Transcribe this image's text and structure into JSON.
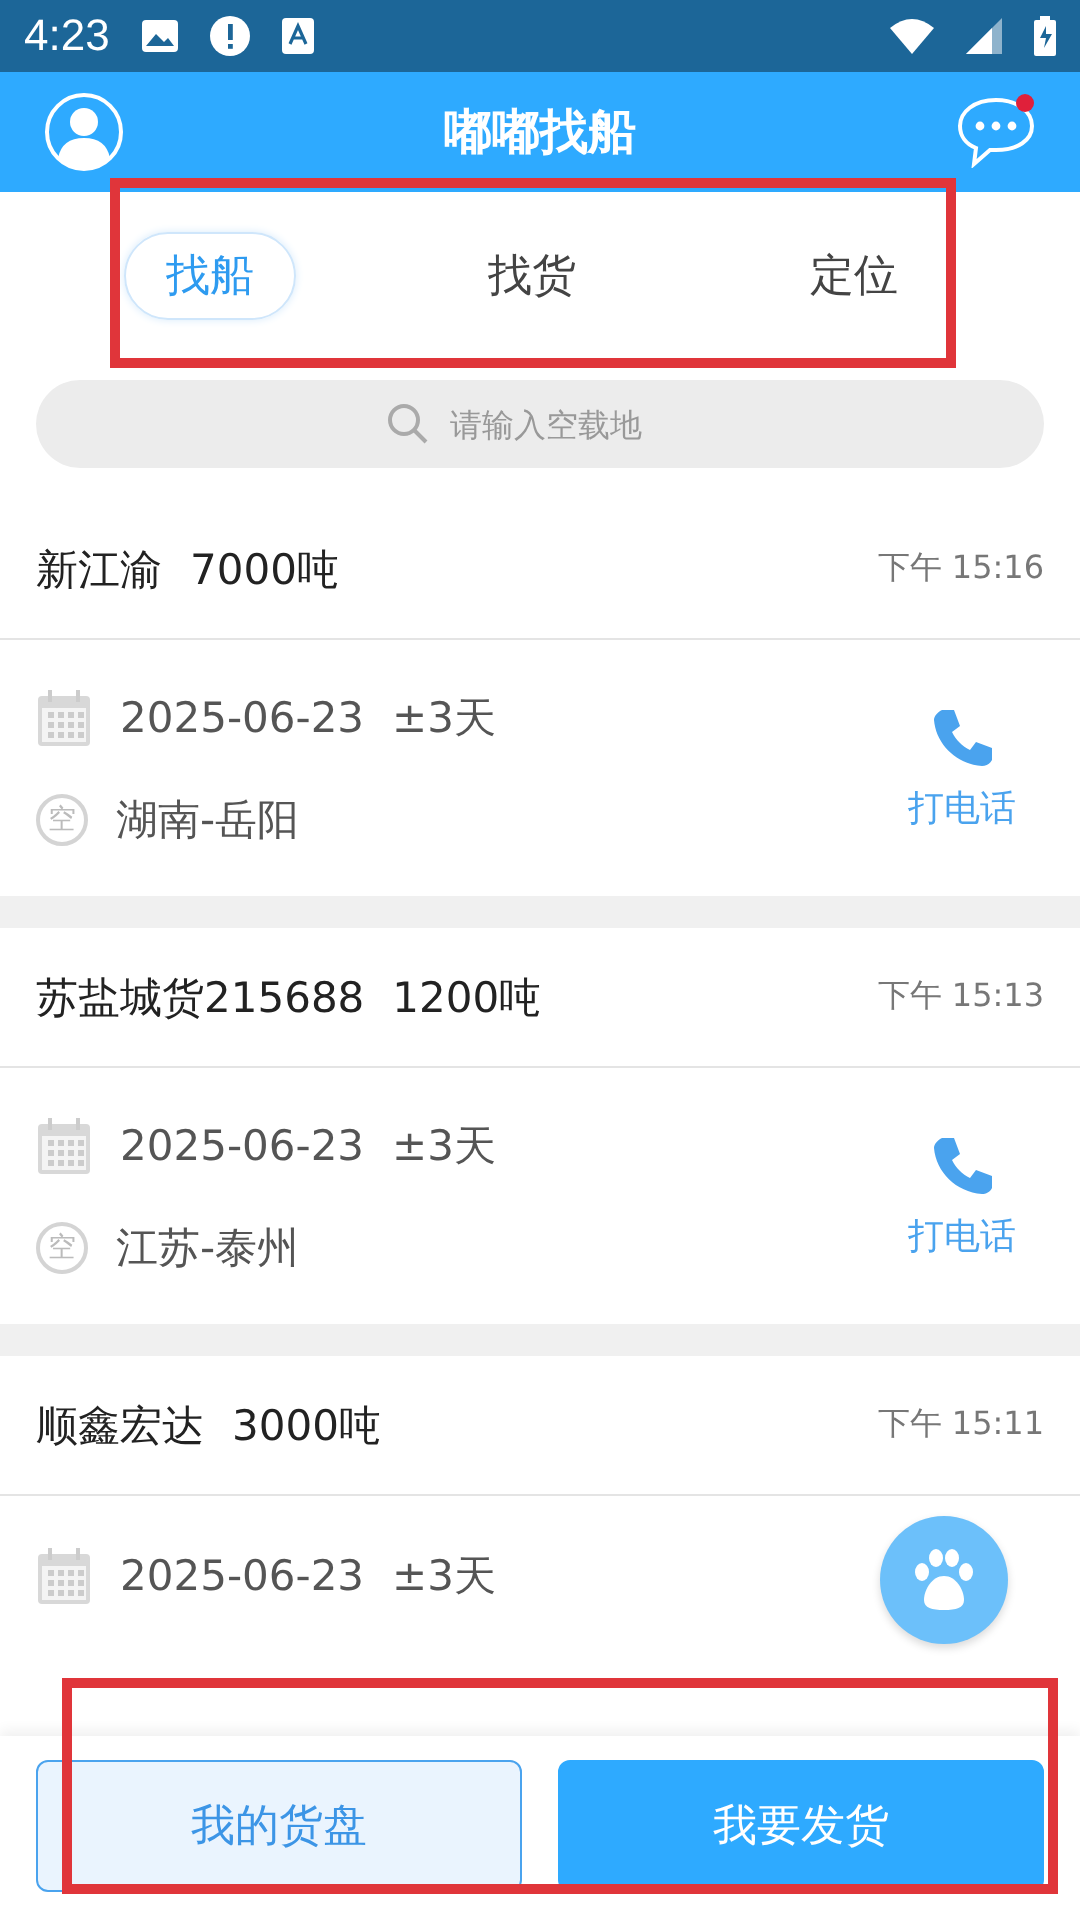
{
  "status_bar": {
    "time": "4:23"
  },
  "app_bar": {
    "title": "嘟嘟找船",
    "has_unread": true
  },
  "tabs": [
    {
      "label": "找船",
      "selected": true
    },
    {
      "label": "找货",
      "selected": false
    },
    {
      "label": "定位",
      "selected": false
    }
  ],
  "search": {
    "placeholder": "请输入空载地"
  },
  "ships": [
    {
      "name": "新江渝",
      "tonnage": "7000吨",
      "time": "下午 15:16",
      "date": "2025-06-23",
      "range": "±3天",
      "badge": "空",
      "location": "湖南-岳阳",
      "call": "打电话"
    },
    {
      "name": "苏盐城货215688",
      "tonnage": "1200吨",
      "time": "下午 15:13",
      "date": "2025-06-23",
      "range": "±3天",
      "badge": "空",
      "location": "江苏-泰州",
      "call": "打电话"
    },
    {
      "name": "顺鑫宏达",
      "tonnage": "3000吨",
      "time": "下午 15:11",
      "date": "2025-06-23",
      "range": "±3天"
    }
  ],
  "bottom_buttons": [
    {
      "label": "我的货盘",
      "kind": "outline"
    },
    {
      "label": "我要发货",
      "kind": "filled"
    }
  ]
}
